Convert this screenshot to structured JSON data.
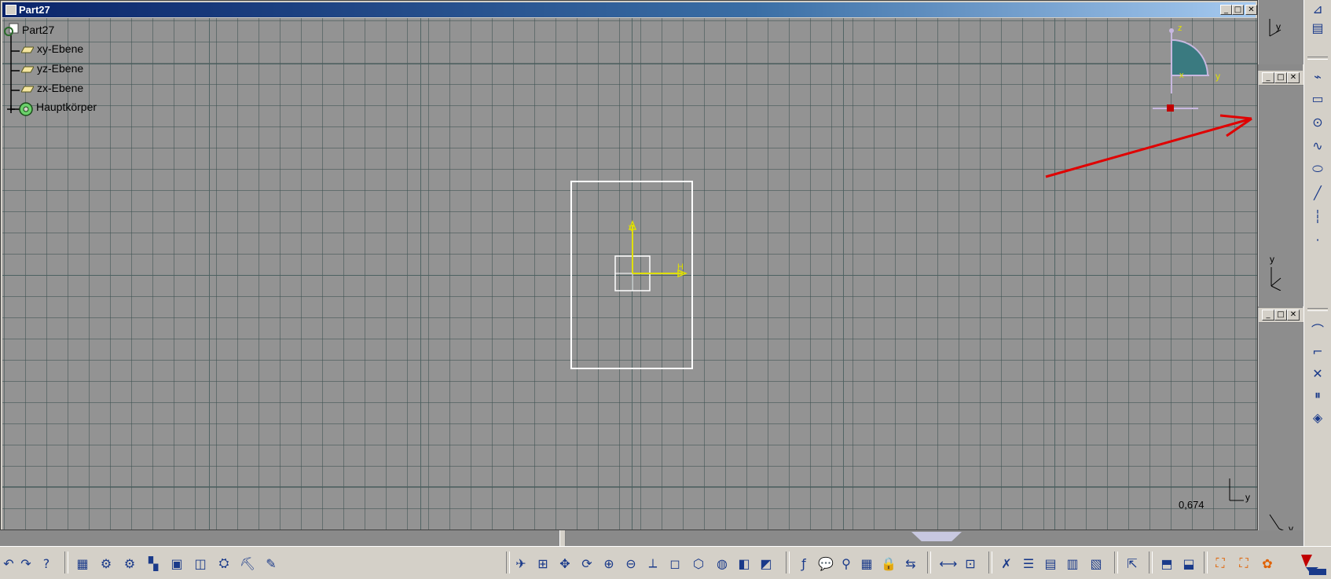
{
  "window": {
    "title": "Part27",
    "controls": [
      "minimize",
      "maximize",
      "close"
    ]
  },
  "tree": {
    "root": "Part27",
    "items": [
      {
        "label": "xy-Ebene",
        "icon": "plane-icon"
      },
      {
        "label": "yz-Ebene",
        "icon": "plane-icon"
      },
      {
        "label": "zx-Ebene",
        "icon": "plane-icon"
      },
      {
        "label": "Hauptkörper",
        "icon": "body-gear-icon"
      }
    ]
  },
  "compass": {
    "z": "z",
    "y": "y",
    "x": "x"
  },
  "sketch_axes": {
    "v": "V",
    "h": "H"
  },
  "axis_labels": {
    "y": "y"
  },
  "status": {
    "zoom_value": "0,674"
  },
  "colors": {
    "background": "#939393",
    "grid": "#4a6060",
    "axis_yellow": "#e0e000",
    "arrow": "#e00000",
    "titlebar": "#0a246a"
  },
  "right_toolbar": [
    "sketch-icon",
    "positioned-sketch-icon",
    "profile-icon",
    "rectangle-icon",
    "circle-icon",
    "spline-icon",
    "ellipse-icon",
    "line-icon",
    "axis-icon",
    "point-icon",
    "corner-icon",
    "chamfer-icon",
    "trim-icon",
    "mirror-icon",
    "project-3d-icon"
  ],
  "bottom_toolbar": [
    "undo-icon",
    "redo-icon",
    "whats-this-icon",
    "catalog-icon",
    "settings-icon",
    "gears-icon",
    "tree-icon",
    "image-icon",
    "analysis-icon",
    "part-icon",
    "tools-icon",
    "sketcher-icon",
    "fly-icon",
    "fit-all-icon",
    "pan-icon",
    "rotate-icon",
    "zoom-in-icon",
    "zoom-out-icon",
    "normal-view-icon",
    "views-icon",
    "iso-view-icon",
    "shading-icon",
    "hide-show-icon",
    "swap-icon",
    "formula-icon",
    "comment-icon",
    "lock-icon",
    "table-icon",
    "parameters-icon",
    "measure-icon",
    "compare-icon",
    "constraint-icon",
    "list-icon",
    "sheet-icon",
    "sheet2-icon",
    "tool3-icon",
    "select-icon",
    "fill-icon",
    "split-icon",
    "dot-icon",
    "catia-logo"
  ]
}
